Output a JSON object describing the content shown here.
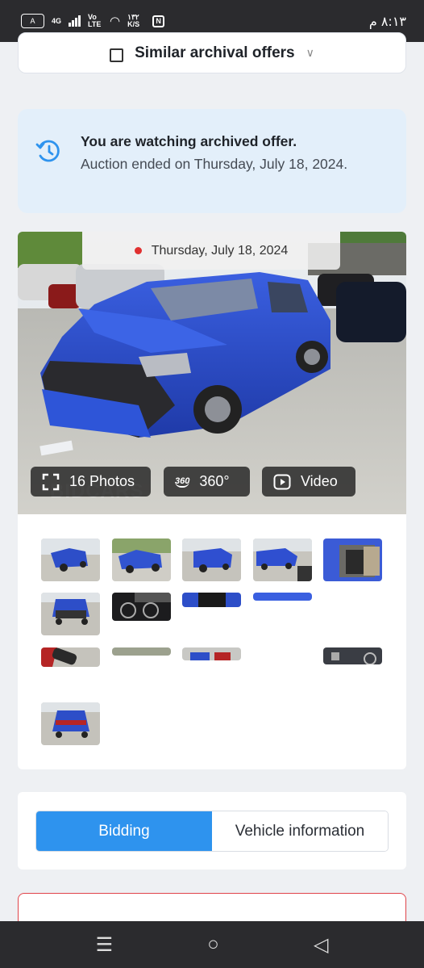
{
  "status_bar": {
    "network_4g": "4G",
    "vo_lte": "Vo LTE",
    "speed": "١٣٢ K/S",
    "nfc": "N",
    "time": "٨:١٣ م"
  },
  "similar": {
    "label": "Similar archival offers"
  },
  "archived": {
    "title": "You are watching archived offer.",
    "subtitle": "Auction ended on Thursday, July 18, 2024."
  },
  "gallery": {
    "date": "Thursday, July 18, 2024",
    "photos_label": "16 Photos",
    "three60_label": "360°",
    "three60_badge": "360",
    "video_label": "Video",
    "watermark": "BIDCARS",
    "thumbnail_count": 16
  },
  "tabs": {
    "bidding": "Bidding",
    "vehicle_info": "Vehicle information"
  },
  "colors": {
    "accent": "#2e93ee",
    "notice_bg": "#e3effa",
    "car_blue": "#2d4ec8",
    "alert_border": "#e0444a"
  }
}
